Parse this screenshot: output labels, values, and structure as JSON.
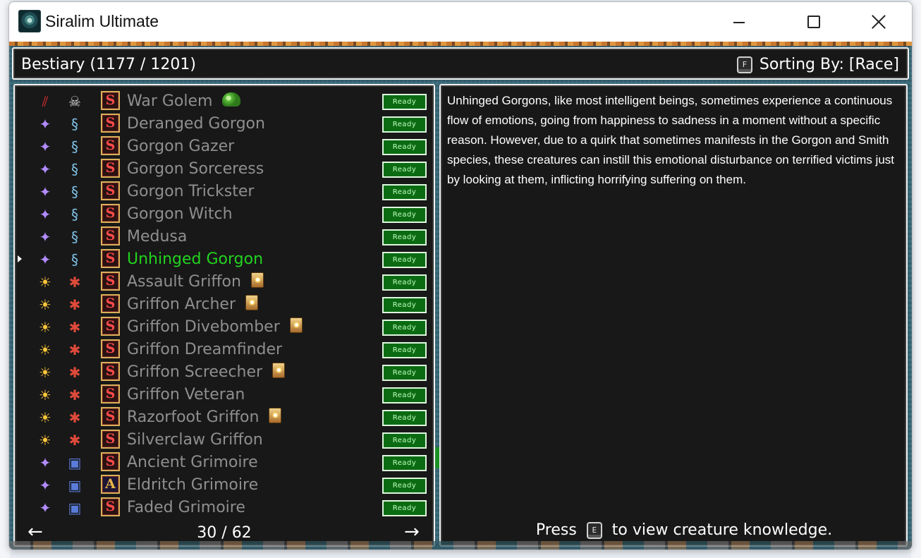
{
  "window": {
    "title": "Siralim Ultimate",
    "controls": [
      "minimize",
      "maximize",
      "close"
    ]
  },
  "header": {
    "title": "Bestiary (1177 / 1201)",
    "sort_key": "F",
    "sort_label": "Sorting By: [Race]"
  },
  "list": {
    "rows": [
      {
        "name": "War Golem",
        "class_icon": "claw-slash-icon",
        "race_icon": "skull-icon",
        "skill_icon": "S",
        "extra_icon": "slime-icon",
        "status": "Ready",
        "selected": false
      },
      {
        "name": "Deranged Gorgon",
        "class_icon": "sorcery-star-icon",
        "race_icon": "gorgon-snake-icon",
        "skill_icon": "S",
        "extra_icon": "",
        "status": "Ready",
        "selected": false
      },
      {
        "name": "Gorgon Gazer",
        "class_icon": "sorcery-star-icon",
        "race_icon": "gorgon-snake-icon",
        "skill_icon": "S",
        "extra_icon": "",
        "status": "Ready",
        "selected": false
      },
      {
        "name": "Gorgon Sorceress",
        "class_icon": "sorcery-star-icon",
        "race_icon": "gorgon-snake-icon",
        "skill_icon": "S",
        "extra_icon": "",
        "status": "Ready",
        "selected": false
      },
      {
        "name": "Gorgon Trickster",
        "class_icon": "sorcery-star-icon",
        "race_icon": "gorgon-snake-icon",
        "skill_icon": "S",
        "extra_icon": "",
        "status": "Ready",
        "selected": false
      },
      {
        "name": "Gorgon Witch",
        "class_icon": "sorcery-star-icon",
        "race_icon": "gorgon-snake-icon",
        "skill_icon": "S",
        "extra_icon": "",
        "status": "Ready",
        "selected": false
      },
      {
        "name": "Medusa",
        "class_icon": "sorcery-star-icon",
        "race_icon": "gorgon-snake-icon",
        "skill_icon": "S",
        "extra_icon": "",
        "status": "Ready",
        "selected": false
      },
      {
        "name": "Unhinged Gorgon",
        "class_icon": "sorcery-star-icon",
        "race_icon": "gorgon-snake-icon",
        "skill_icon": "S",
        "extra_icon": "",
        "status": "Ready",
        "selected": true
      },
      {
        "name": "Assault Griffon",
        "class_icon": "sun-icon",
        "race_icon": "griffon-icon",
        "skill_icon": "S",
        "extra_icon": "card-icon",
        "status": "Ready",
        "selected": false
      },
      {
        "name": "Griffon Archer",
        "class_icon": "sun-icon",
        "race_icon": "griffon-icon",
        "skill_icon": "S",
        "extra_icon": "card-icon",
        "status": "Ready",
        "selected": false
      },
      {
        "name": "Griffon Divebomber",
        "class_icon": "sun-icon",
        "race_icon": "griffon-icon",
        "skill_icon": "S",
        "extra_icon": "card-icon",
        "status": "Ready",
        "selected": false
      },
      {
        "name": "Griffon Dreamfinder",
        "class_icon": "sun-icon",
        "race_icon": "griffon-icon",
        "skill_icon": "S",
        "extra_icon": "",
        "status": "Ready",
        "selected": false
      },
      {
        "name": "Griffon Screecher",
        "class_icon": "sun-icon",
        "race_icon": "griffon-icon",
        "skill_icon": "S",
        "extra_icon": "card-icon",
        "status": "Ready",
        "selected": false
      },
      {
        "name": "Griffon Veteran",
        "class_icon": "sun-icon",
        "race_icon": "griffon-icon",
        "skill_icon": "S",
        "extra_icon": "",
        "status": "Ready",
        "selected": false
      },
      {
        "name": "Razorfoot Griffon",
        "class_icon": "sun-icon",
        "race_icon": "griffon-icon",
        "skill_icon": "S",
        "extra_icon": "card-icon",
        "status": "Ready",
        "selected": false
      },
      {
        "name": "Silverclaw Griffon",
        "class_icon": "sun-icon",
        "race_icon": "griffon-icon",
        "skill_icon": "S",
        "extra_icon": "",
        "status": "Ready",
        "selected": false
      },
      {
        "name": "Ancient Grimoire",
        "class_icon": "sorcery-star-icon",
        "race_icon": "grimoire-icon",
        "skill_icon": "S",
        "extra_icon": "",
        "status": "Ready",
        "selected": false
      },
      {
        "name": "Eldritch Grimoire",
        "class_icon": "sorcery-star-icon",
        "race_icon": "grimoire-icon",
        "skill_icon": "A",
        "extra_icon": "",
        "status": "Ready",
        "selected": false
      },
      {
        "name": "Faded Grimoire",
        "class_icon": "sorcery-star-icon",
        "race_icon": "grimoire-icon",
        "skill_icon": "S",
        "extra_icon": "",
        "status": "Ready",
        "selected": false
      }
    ],
    "page_text": "30 / 62",
    "prev_arrow": "←",
    "next_arrow": "→"
  },
  "description": {
    "text": "Unhinged Gorgons, like most intelligent beings, sometimes experience a continuous flow of emotions, going from happiness to sadness in a moment without a specific reason. However, due to a quirk that sometimes manifests in the Gorgon and Smith species, these creatures can instill this emotional disturbance on terrified victims just by looking at them, inflicting horrifying suffering on them.",
    "hint_prefix": "Press",
    "hint_key": "E",
    "hint_suffix": "to view creature knowledge."
  },
  "colors": {
    "selected_name": "#22d31f",
    "normal_name": "#8f8f8f",
    "ready_bg": "#0b6b12"
  }
}
